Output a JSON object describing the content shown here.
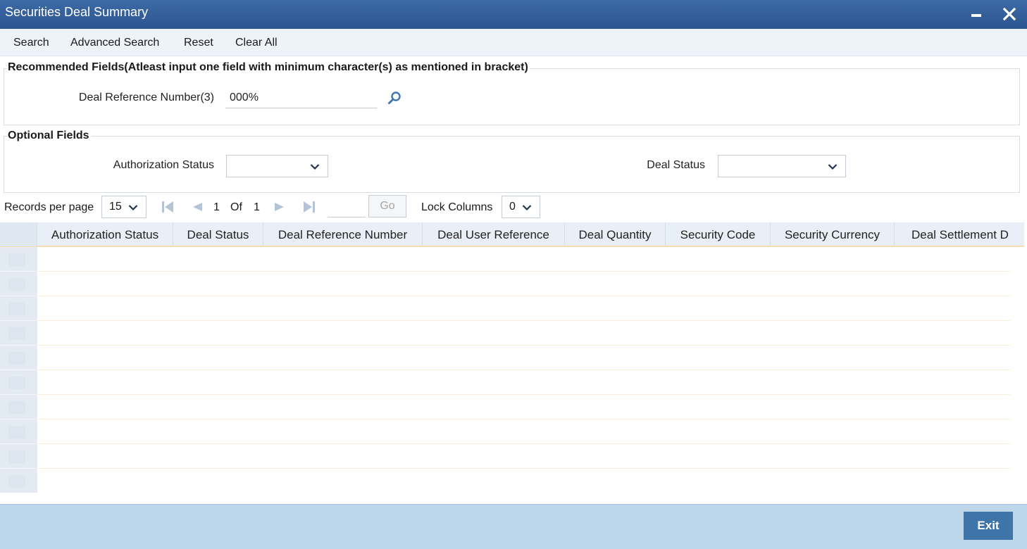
{
  "window": {
    "title": "Securities Deal Summary"
  },
  "toolbar": {
    "search": "Search",
    "advanced_search": "Advanced Search",
    "reset": "Reset",
    "clear_all": "Clear All"
  },
  "recommended": {
    "legend": "Recommended Fields(Atleast input one field with minimum character(s) as mentioned in bracket)",
    "deal_ref_label": "Deal Reference Number(3)",
    "deal_ref_value": "000%"
  },
  "optional": {
    "legend": "Optional Fields",
    "auth_status_label": "Authorization Status",
    "auth_status_value": "",
    "deal_status_label": "Deal Status",
    "deal_status_value": ""
  },
  "pager": {
    "records_label": "Records per page",
    "records_value": "15",
    "current_page": "1",
    "of_label": "Of",
    "total_pages": "1",
    "go_label": "Go",
    "lock_label": "Lock Columns",
    "lock_value": "0"
  },
  "grid": {
    "columns": [
      "Authorization Status",
      "Deal Status",
      "Deal Reference Number",
      "Deal User Reference",
      "Deal Quantity",
      "Security Code",
      "Security Currency",
      "Deal Settlement D"
    ],
    "row_count": 10
  },
  "footer": {
    "exit_label": "Exit"
  },
  "colors": {
    "titlebar": "#2c5590",
    "footer": "#bdd6ea",
    "exit_button": "#3f74a8"
  },
  "icons": [
    "minimize-icon",
    "close-icon",
    "search-icon",
    "chevron-down-icon",
    "first-page-icon",
    "previous-page-icon",
    "next-page-icon",
    "last-page-icon"
  ]
}
